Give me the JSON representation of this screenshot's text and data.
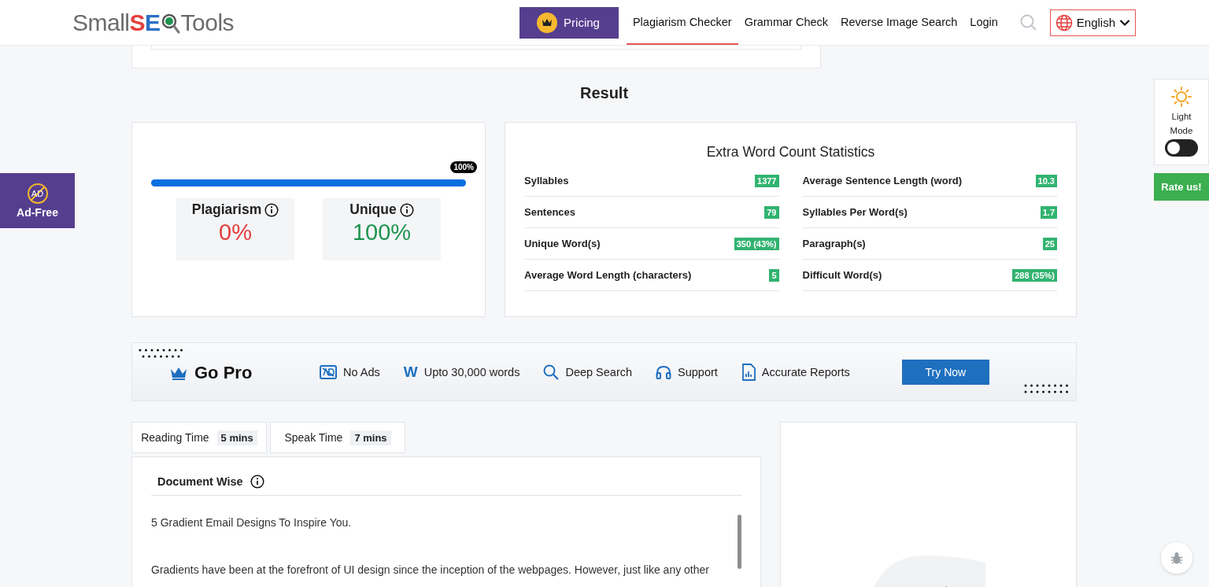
{
  "header": {
    "logo": {
      "prefix": "Small",
      "letter_1": "S",
      "letter_2": "E",
      "suffix": "Tools"
    },
    "nav": [
      {
        "label": "Pricing",
        "kind": "premium",
        "selected": false
      },
      {
        "label": "Plagiarism Checker",
        "kind": "link",
        "selected": true
      },
      {
        "label": "Grammar Check",
        "kind": "link",
        "selected": false
      },
      {
        "label": "Reverse Image Search",
        "kind": "link",
        "selected": false
      },
      {
        "label": "Login",
        "kind": "link",
        "selected": false
      }
    ],
    "language": "English"
  },
  "result": {
    "title": "Result",
    "bar": {
      "level": 1,
      "tooltip": "100%"
    },
    "scores": [
      {
        "label": "Plagiarism",
        "value": "0%",
        "color": "#e33e3e"
      },
      {
        "label": "Unique",
        "value": "100%",
        "color": "#1f944f"
      }
    ]
  },
  "stats": {
    "title": "Extra Word Count Statistics",
    "columns": [
      [
        {
          "label": "Syllables",
          "value": "1377"
        },
        {
          "label": "Sentences",
          "value": "79"
        },
        {
          "label": "Unique Word(s)",
          "value": "350 (43%)"
        },
        {
          "label": "Average Word Length (characters)",
          "value": "5"
        }
      ],
      [
        {
          "label": "Average Sentence Length (word)",
          "value": "10.3"
        },
        {
          "label": "Syllables Per Word(s)",
          "value": "1.7"
        },
        {
          "label": "Paragraph(s)",
          "value": "25"
        },
        {
          "label": "Difficult Word(s)",
          "value": "288 (35%)"
        }
      ]
    ]
  },
  "go_pro": {
    "title": "Go Pro",
    "features": [
      {
        "kind": "no-ads",
        "label": "No Ads"
      },
      {
        "kind": "letter",
        "glyph": "W",
        "label": "Upto 30,000 words"
      },
      {
        "kind": "search",
        "label": "Deep Search"
      },
      {
        "kind": "support",
        "label": "Support"
      },
      {
        "kind": "report",
        "label": "Accurate Reports"
      }
    ],
    "button": "Try Now"
  },
  "time_tabs": [
    {
      "label": "Reading Time",
      "value": "5 mins"
    },
    {
      "label": "Speak Time",
      "value": "7 mins"
    }
  ],
  "document": {
    "title": "Document Wise",
    "paragraphs": [
      "5 Gradient Email Designs To Inspire You.",
      "Gradients have been at the forefront of UI design since the inception of the webpages. However, just like any other"
    ]
  },
  "side": {
    "ad_free": {
      "badge": "AD",
      "label": "Ad-Free"
    },
    "theme": {
      "label": "Light Mode",
      "on": false
    },
    "rate": "Rate us!"
  }
}
